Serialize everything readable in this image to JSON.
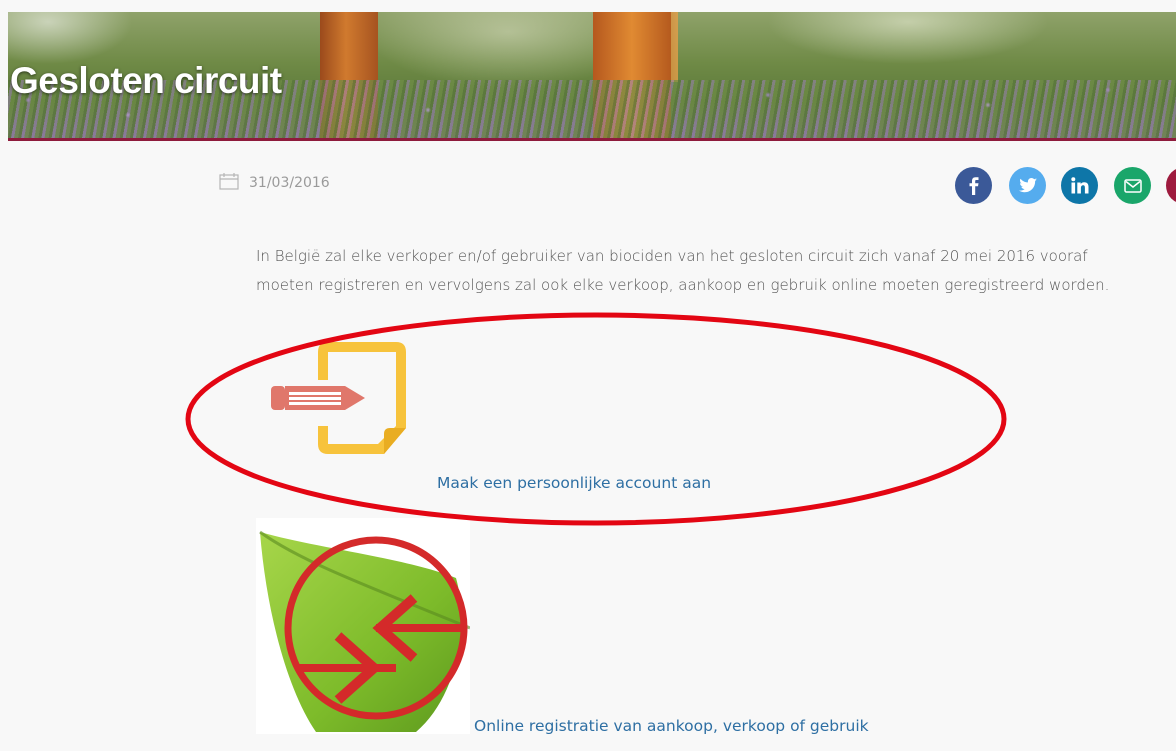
{
  "header": {
    "title": "Gesloten circuit",
    "accent_color": "#8e1b3c"
  },
  "meta": {
    "date_icon": "calendar-icon",
    "date": "31/03/2016"
  },
  "share": [
    {
      "name": "facebook",
      "icon": "facebook-icon",
      "color": "#3b5998"
    },
    {
      "name": "twitter",
      "icon": "twitter-icon",
      "color": "#55acee"
    },
    {
      "name": "linkedin",
      "icon": "linkedin-icon",
      "color": "#0e76a8"
    },
    {
      "name": "email",
      "icon": "mail-icon",
      "color": "#1aa66a"
    },
    {
      "name": "pinterest",
      "icon": "pinterest-icon",
      "color": "#9e1b3e"
    }
  ],
  "article": {
    "intro_line1": "In België zal elke verkoper en/of gebruiker  van biociden van het gesloten circuit zich vanaf 20 mei 2016 vooraf",
    "intro_line2": "moeten registreren en vervolgens zal ook elke verkoop, aankoop en gebruik online moeten geregistreerd worden.",
    "link_account": "Maak een persoonlijke account aan",
    "link_registration": "Online registratie van aankoop, verkoop of gebruik",
    "link_color": "#2e6fa3"
  },
  "annotation": {
    "color": "#e30613"
  }
}
